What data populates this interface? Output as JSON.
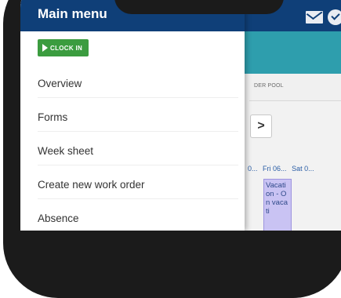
{
  "drawer": {
    "title": "Main menu",
    "clock_in_label": "CLOCK IN",
    "items": [
      "Overview",
      "Forms",
      "Week sheet",
      "Create new work order",
      "Absence"
    ]
  },
  "background": {
    "tab_label": "DER POOL",
    "next_arrow": ">",
    "days": [
      "0...",
      "Fri 06...",
      "Sat 0..."
    ],
    "event_text": "Vacati on - On vacati"
  },
  "icons": {
    "mail": "envelope-icon",
    "sync": "cloud-check-icon",
    "clock": "play-icon",
    "next": "chevron-right-icon"
  },
  "colors": {
    "header": "#0f3f78",
    "teal_band": "#2e9ead",
    "clock_in": "#3b9c3f",
    "event_bg": "#c9c3f3"
  }
}
